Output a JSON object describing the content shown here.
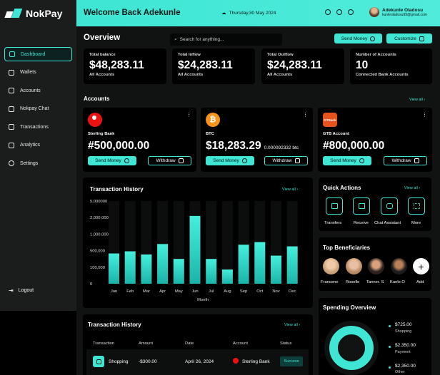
{
  "app": {
    "name": "NokPay"
  },
  "colors": {
    "accent": "#3ee6d3",
    "background": "#111312",
    "card": "#000000",
    "danger": "#e11111",
    "btc": "#f7931a",
    "gtb": "#e8521c"
  },
  "header": {
    "welcome": "Welcome Back Adekunle",
    "date": "Thursday,30 May 2024",
    "user_name": "Adekunle Oladosu",
    "user_email": "kunleoladosu99@gmail.com",
    "icons": [
      "moon-icon",
      "notification-icon",
      "mic-icon"
    ]
  },
  "sidebar": {
    "items": [
      {
        "label": "Dashboard",
        "icon": "home-icon",
        "active": true
      },
      {
        "label": "Wallets",
        "icon": "wallet-icon"
      },
      {
        "label": "Accounts",
        "icon": "users-icon"
      },
      {
        "label": "Nokpay Chat",
        "icon": "chat-icon"
      },
      {
        "label": "Transactions",
        "icon": "transactions-icon"
      },
      {
        "label": "Analytics",
        "icon": "analytics-icon"
      },
      {
        "label": "Settings",
        "icon": "gear-icon"
      }
    ],
    "logout": "Logout"
  },
  "overview": {
    "title": "Overview",
    "search_placeholder": "Search  for anything...",
    "send_money": "Send Money",
    "customize": "Customize"
  },
  "stats": [
    {
      "label": "Total balance",
      "value": "$48,283.11",
      "sub": "All Accounts"
    },
    {
      "label": "Total Inflow",
      "value": "$24,283.11",
      "sub": "All Accounts"
    },
    {
      "label": "Total Outflow",
      "value": "$24,283.11",
      "sub": "All Accounts"
    },
    {
      "label": "Number of Accounts",
      "value": "10",
      "sub": "Connected Bank Accounts"
    }
  ],
  "accounts": {
    "title": "Accounts",
    "view_all": "View all  ›",
    "cards": [
      {
        "bank": "Sterling Bank",
        "balance": "#500,000.00",
        "extra": "",
        "send": "Send Money",
        "withdraw": "Withdraw"
      },
      {
        "bank": "BTC",
        "balance": "$18,283.29",
        "extra": "0.000092332 btc",
        "send": "Send Money",
        "withdraw": "Withdraw"
      },
      {
        "bank": "GTB Account",
        "balance": "#800,000.00",
        "extra": "",
        "send": "Send Money",
        "withdraw": "Withdraw",
        "logo_text": "GTBank"
      }
    ]
  },
  "chart_panel": {
    "title": "Transaction History",
    "view_all": "View all  ›"
  },
  "chart_data": {
    "type": "bar",
    "categories": [
      "Jan",
      "Feb",
      "Mar",
      "Apr",
      "May",
      "Jun",
      "Jul",
      "Aug",
      "Sep",
      "Oct",
      "Nov",
      "Dec"
    ],
    "y_tick_labels": [
      "5,000000",
      "2,000,000",
      "1,000,000",
      "500,000",
      "100,000",
      "0"
    ],
    "values": [
      1.83,
      1.96,
      1.77,
      2.4,
      1.5,
      4.1,
      1.5,
      0.86,
      2.36,
      2.52,
      1.7,
      2.26
    ],
    "xlabel": "Month",
    "ylabel": "",
    "scale_note": "values in tick-index units (0 = 0, 1 = 100,000, 2 = 500,000, 3 = 1,000,000, 4 = 2,000,000, 5 = 5,000000)"
  },
  "tx_panel": {
    "title": "Transaction History",
    "view_all": "View all  ›",
    "headers": [
      "Transaction",
      "Amount",
      "Date",
      "Account",
      "Status"
    ],
    "row": {
      "name": "Shopping",
      "amount": "-$300.00",
      "date": "April 26, 2024",
      "account": "Sterling Bank",
      "status": "Success"
    }
  },
  "quick_actions": {
    "title": "Quick Actions",
    "view_all": "View all  ›",
    "items": [
      {
        "label": "Transfers",
        "icon": "transfer-icon"
      },
      {
        "label": "Receive",
        "icon": "receive-icon"
      },
      {
        "label": "Chat Assistant",
        "icon": "chat-assistant-icon"
      },
      {
        "label": "More",
        "icon": "grid-icon"
      }
    ]
  },
  "beneficiaries": {
    "title": "Top Beneficiaries",
    "items": [
      {
        "name": "Francene"
      },
      {
        "name": "Roselle"
      },
      {
        "name": "Tanner. S"
      },
      {
        "name": "Kunle.O"
      }
    ],
    "add": "Add"
  },
  "spending": {
    "title": "Spending Overview",
    "legend": [
      {
        "value": "$725.00",
        "label": "Shopping"
      },
      {
        "value": "$2,350.00",
        "label": "Payment"
      },
      {
        "value": "$2,350.00",
        "label": "Other"
      }
    ]
  }
}
